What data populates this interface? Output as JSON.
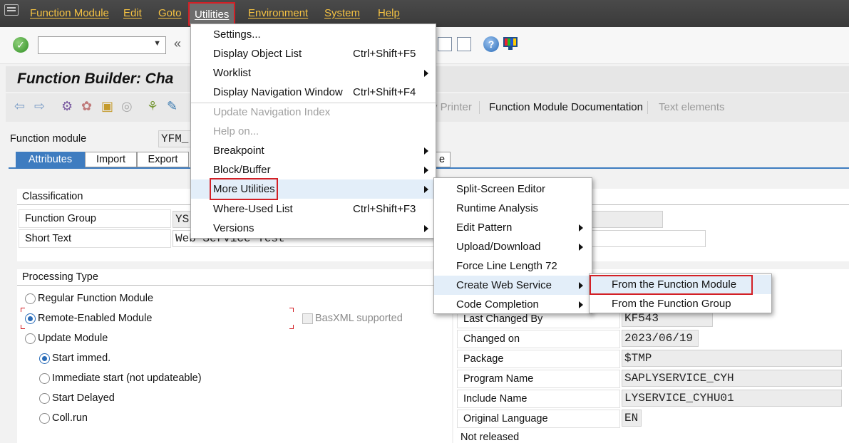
{
  "menubar": {
    "items": [
      {
        "label": "Function Module"
      },
      {
        "label": "Edit"
      },
      {
        "label": "Goto"
      },
      {
        "label": "Utilities"
      },
      {
        "label": "Environment"
      },
      {
        "label": "System"
      },
      {
        "label": "Help"
      }
    ]
  },
  "title": "Function Builder: Cha",
  "app_toolbar": {
    "printer": "y Printer",
    "fm_doc": "Function Module Documentation",
    "text_elements": "Text elements"
  },
  "form": {
    "function_module_label": "Function module",
    "function_module_value": "YFM_",
    "tabs": [
      "Attributes",
      "Import",
      "Export",
      "e"
    ],
    "classification": {
      "title": "Classification",
      "function_group_label": "Function Group",
      "function_group_value": "YS",
      "short_text_label": "Short Text",
      "short_text_value": "Web Service Test"
    },
    "processing": {
      "title": "Processing Type",
      "regular": "Regular Function Module",
      "remote": "Remote-Enabled Module",
      "basxml": "BasXML supported",
      "update": "Update Module",
      "start_immed": "Start immed.",
      "immediate_start": "Immediate start (not updateable)",
      "start_delayed": "Start Delayed",
      "coll_run": "Coll.run"
    },
    "general": {
      "last_changed_by_label": "Last Changed By",
      "last_changed_by_value": "KF543",
      "changed_on_label": "Changed on",
      "changed_on_value": "2023/06/19",
      "package_label": "Package",
      "package_value": "$TMP",
      "program_name_label": "Program Name",
      "program_name_value": "SAPLYSERVICE_CYH",
      "include_name_label": "Include Name",
      "include_name_value": "LYSERVICE_CYHU01",
      "original_language_label": "Original Language",
      "original_language_value": "EN",
      "not_released": "Not released"
    }
  },
  "utilities_menu": {
    "settings": "Settings...",
    "display_object_list": "Display Object List",
    "display_object_list_sc": "Ctrl+Shift+F5",
    "worklist": "Worklist",
    "display_nav_window": "Display Navigation Window",
    "display_nav_window_sc": "Ctrl+Shift+F4",
    "update_nav_index": "Update Navigation Index",
    "help_on": "Help on...",
    "breakpoint": "Breakpoint",
    "block_buffer": "Block/Buffer",
    "more_utilities": "More Utilities",
    "where_used": "Where-Used List",
    "where_used_sc": "Ctrl+Shift+F3",
    "versions": "Versions"
  },
  "more_utilities_menu": {
    "split_screen": "Split-Screen Editor",
    "runtime_analysis": "Runtime Analysis",
    "edit_pattern": "Edit Pattern",
    "upload_download": "Upload/Download",
    "force_line_length": "Force Line Length 72",
    "create_web_service": "Create Web Service",
    "code_completion": "Code Completion"
  },
  "web_service_menu": {
    "from_function_module": "From the Function Module",
    "from_function_group": "From the Function Group"
  },
  "colors": {
    "menubar_bg": "#3f3f3f",
    "menu_text": "#f5c242",
    "highlight_box": "#d32026",
    "tab_active": "#3e7cc0"
  }
}
